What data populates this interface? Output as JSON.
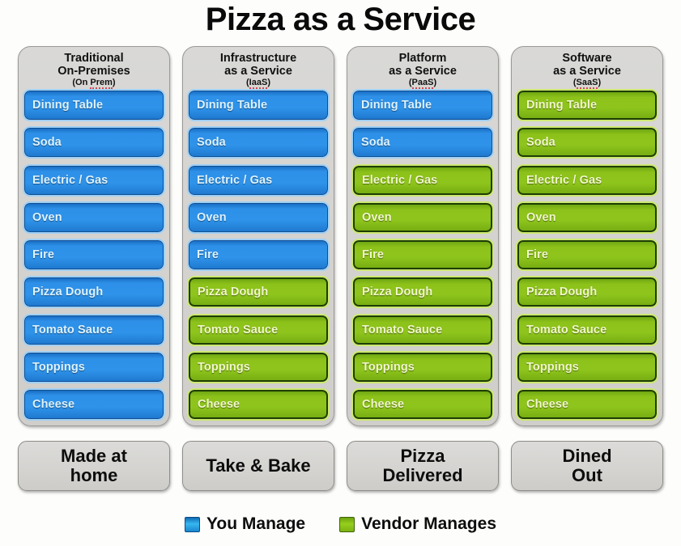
{
  "title": "Pizza as a Service",
  "colors": {
    "you_manage": "#2f93ea",
    "vendor_manages": "#8ec51c",
    "panel": "#d5d4d1",
    "text_dark": "#0d0d0d"
  },
  "columns": [
    {
      "header_line1": "Traditional",
      "header_line2": "On-Premises",
      "abbr_prefix": "(On ",
      "abbr_spell": "Prem",
      "abbr_suffix": ")",
      "outcome": "Made at\nhome",
      "items": [
        {
          "label": "Dining Table",
          "owner": "you"
        },
        {
          "label": "Soda",
          "owner": "you"
        },
        {
          "label": "Electric / Gas",
          "owner": "you"
        },
        {
          "label": "Oven",
          "owner": "you"
        },
        {
          "label": "Fire",
          "owner": "you"
        },
        {
          "label": "Pizza Dough",
          "owner": "you"
        },
        {
          "label": "Tomato Sauce",
          "owner": "you"
        },
        {
          "label": "Toppings",
          "owner": "you"
        },
        {
          "label": "Cheese",
          "owner": "you"
        }
      ]
    },
    {
      "header_line1": "Infrastructure",
      "header_line2": "as a Service",
      "abbr_prefix": "(",
      "abbr_spell": "IaaS",
      "abbr_suffix": ")",
      "outcome": "Take & Bake",
      "items": [
        {
          "label": "Dining Table",
          "owner": "you"
        },
        {
          "label": "Soda",
          "owner": "you"
        },
        {
          "label": "Electric / Gas",
          "owner": "you"
        },
        {
          "label": "Oven",
          "owner": "you"
        },
        {
          "label": "Fire",
          "owner": "you"
        },
        {
          "label": "Pizza Dough",
          "owner": "vendor"
        },
        {
          "label": "Tomato Sauce",
          "owner": "vendor"
        },
        {
          "label": "Toppings",
          "owner": "vendor"
        },
        {
          "label": "Cheese",
          "owner": "vendor"
        }
      ]
    },
    {
      "header_line1": "Platform",
      "header_line2": "as a Service",
      "abbr_prefix": "(",
      "abbr_spell": "PaaS",
      "abbr_suffix": ")",
      "outcome": "Pizza\nDelivered",
      "items": [
        {
          "label": "Dining Table",
          "owner": "you"
        },
        {
          "label": "Soda",
          "owner": "you"
        },
        {
          "label": "Electric / Gas",
          "owner": "vendor"
        },
        {
          "label": "Oven",
          "owner": "vendor"
        },
        {
          "label": "Fire",
          "owner": "vendor"
        },
        {
          "label": "Pizza Dough",
          "owner": "vendor"
        },
        {
          "label": "Tomato Sauce",
          "owner": "vendor"
        },
        {
          "label": "Toppings",
          "owner": "vendor"
        },
        {
          "label": "Cheese",
          "owner": "vendor"
        }
      ]
    },
    {
      "header_line1": "Software",
      "header_line2": "as a Service",
      "abbr_prefix": "(",
      "abbr_spell": "SaaS",
      "abbr_suffix": ")",
      "outcome": "Dined\nOut",
      "items": [
        {
          "label": "Dining Table",
          "owner": "vendor"
        },
        {
          "label": "Soda",
          "owner": "vendor"
        },
        {
          "label": "Electric / Gas",
          "owner": "vendor"
        },
        {
          "label": "Oven",
          "owner": "vendor"
        },
        {
          "label": "Fire",
          "owner": "vendor"
        },
        {
          "label": "Pizza Dough",
          "owner": "vendor"
        },
        {
          "label": "Tomato Sauce",
          "owner": "vendor"
        },
        {
          "label": "Toppings",
          "owner": "vendor"
        },
        {
          "label": "Cheese",
          "owner": "vendor"
        }
      ]
    }
  ],
  "legend": [
    {
      "swatch": "blue",
      "label": "You Manage"
    },
    {
      "swatch": "green",
      "label": "Vendor Manages"
    }
  ]
}
